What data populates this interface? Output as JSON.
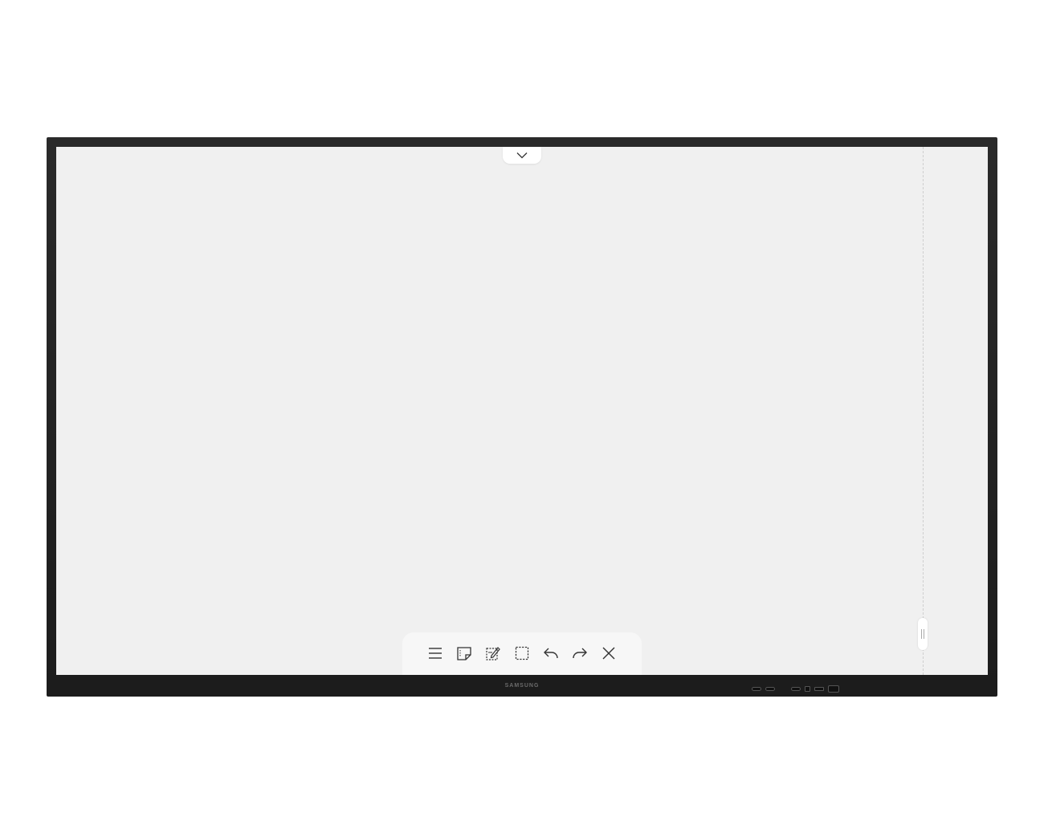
{
  "device": {
    "brand_label": "SAMSUNG"
  },
  "screen": {
    "background_color": "#f0f0f0"
  },
  "top_tab": {
    "icon": "chevron-down-icon"
  },
  "side_handle": {
    "icon": "drag-handle-icon"
  },
  "toolbar": {
    "tools": [
      {
        "name": "menu",
        "icon": "hamburger-menu-icon"
      },
      {
        "name": "sticky-note",
        "icon": "sticky-note-icon"
      },
      {
        "name": "edit-note",
        "icon": "edit-note-icon"
      },
      {
        "name": "selection",
        "icon": "dashed-selection-icon"
      },
      {
        "name": "undo",
        "icon": "undo-icon"
      },
      {
        "name": "redo",
        "icon": "redo-icon"
      },
      {
        "name": "close",
        "icon": "close-icon"
      }
    ]
  }
}
